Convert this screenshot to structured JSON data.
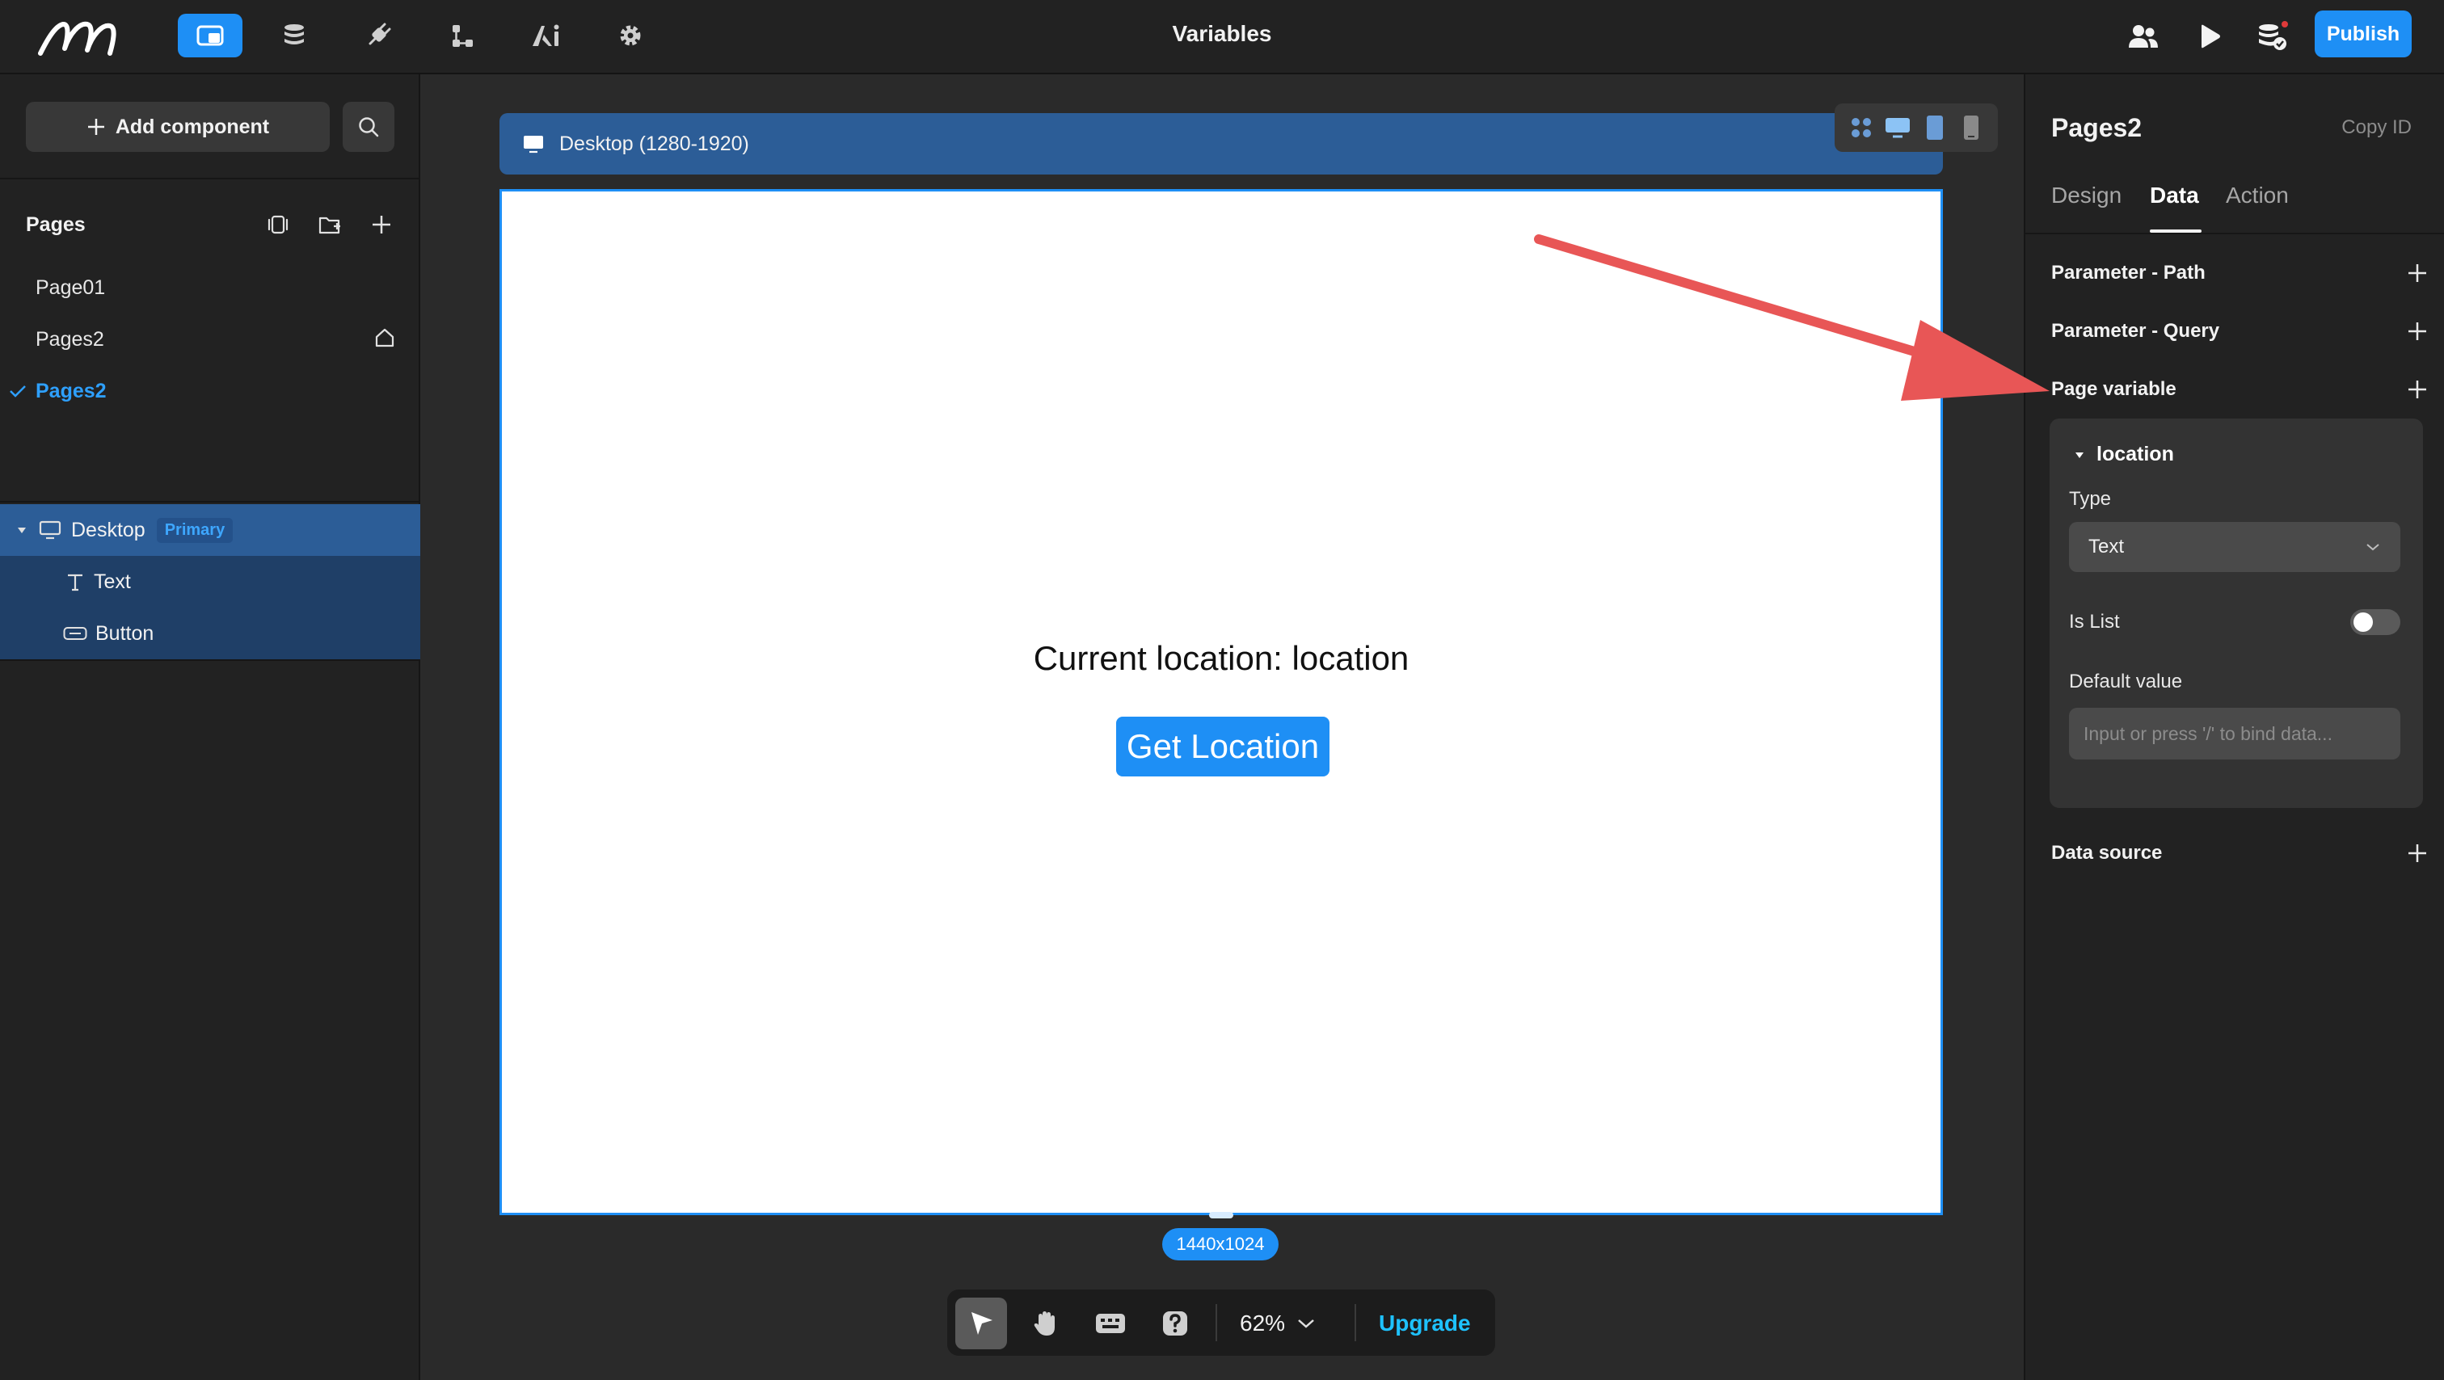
{
  "app": {
    "title": "Variables"
  },
  "topbar": {
    "nav": [
      {
        "name": "pages",
        "icon": "pages-icon"
      },
      {
        "name": "database",
        "icon": "database-icon"
      },
      {
        "name": "plugins",
        "icon": "plug-icon"
      },
      {
        "name": "workflow",
        "icon": "workflow-icon"
      },
      {
        "name": "ai",
        "icon": "ai-icon"
      },
      {
        "name": "settings",
        "icon": "gear-icon"
      }
    ],
    "publish_label": "Publish"
  },
  "left_panel": {
    "add_component_label": "Add component",
    "pages_title": "Pages",
    "pages": [
      {
        "label": "Page01"
      },
      {
        "label": "Pages2"
      },
      {
        "label": "Pages2",
        "selected": true
      }
    ],
    "tree": {
      "root_label": "Desktop",
      "root_badge": "Primary",
      "children": [
        {
          "label": "Text",
          "icon": "text-icon"
        },
        {
          "label": "Button",
          "icon": "button-icon"
        }
      ]
    }
  },
  "canvas": {
    "device_label": "Desktop (1280-1920)",
    "content_text": "Current location: location",
    "button_label": "Get Location",
    "size_label": "1440x1024",
    "zoom_label": "62%",
    "upgrade_label": "Upgrade"
  },
  "right_panel": {
    "title": "Pages2",
    "copy_id_label": "Copy ID",
    "tabs": [
      "Design",
      "Data",
      "Action"
    ],
    "active_tab": "Data",
    "sections": {
      "param_path": "Parameter - Path",
      "param_query": "Parameter - Query",
      "page_variable": "Page variable",
      "data_source": "Data source"
    },
    "variable": {
      "name": "location",
      "type_label": "Type",
      "type_value": "Text",
      "is_list_label": "Is List",
      "is_list": false,
      "default_label": "Default value",
      "default_placeholder": "Input or press '/' to bind data..."
    }
  },
  "colors": {
    "accent": "#1e8ff5",
    "annotation_arrow": "#e85656",
    "panel_bg": "#222222",
    "canvas_bg": "#2a2a2a"
  }
}
